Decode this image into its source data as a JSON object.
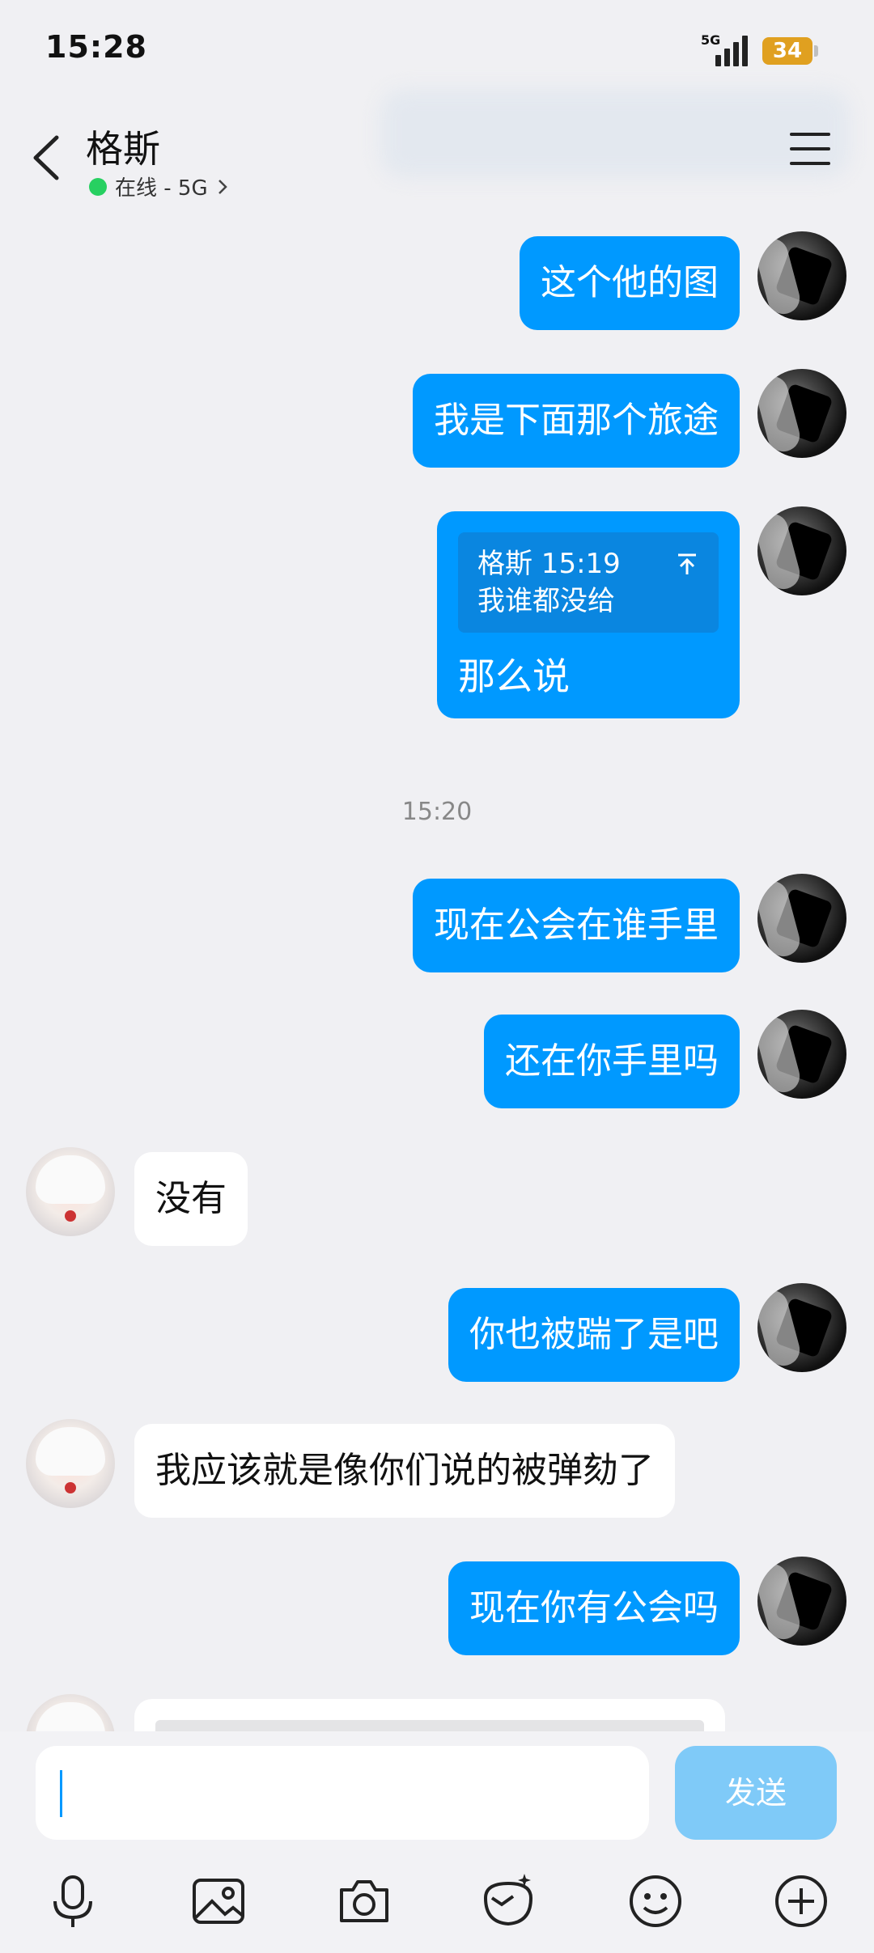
{
  "status": {
    "time": "15:28",
    "network": "5G",
    "battery": "34"
  },
  "header": {
    "title": "格斯",
    "status_text": "在线 - 5G"
  },
  "messages": [
    {
      "text": "这个他的图"
    },
    {
      "text": "我是下面那个旅途"
    },
    {
      "quote_sender": "格斯 15:19",
      "quote_text": "我谁都没给",
      "text": "那么说"
    },
    {
      "text": "现在公会在谁手里"
    },
    {
      "text": "还在你手里吗"
    },
    {
      "text": "没有"
    },
    {
      "text": "你也被踹了是吧"
    },
    {
      "text": "我应该就是像你们说的被弹劾了"
    },
    {
      "text": "现在你有公会吗"
    }
  ],
  "timestamp": "15:20",
  "input": {
    "value": "",
    "send_label": "发送"
  },
  "toolbar": [
    "mic-icon",
    "image-icon",
    "camera-icon",
    "doodle-icon",
    "emoji-icon",
    "plus-icon"
  ]
}
